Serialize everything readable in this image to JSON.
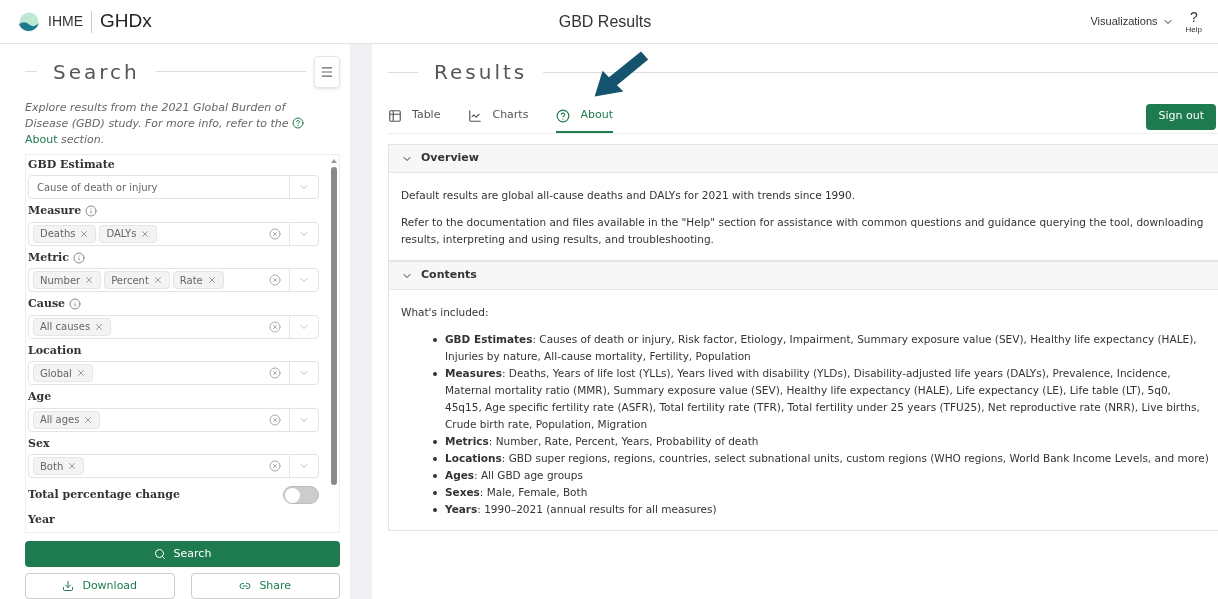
{
  "header": {
    "brand": "IHME",
    "product": "GHDx",
    "title": "GBD Results",
    "menu": "Visualizations",
    "help_glyph": "?",
    "help_label": "Help"
  },
  "sidebar": {
    "title": "Search",
    "description_before": "Explore results from the 2021 Global Burden of Disease (GBD) study. For more info, refer to the",
    "description_link": "About",
    "description_after": "section.",
    "filters": [
      {
        "label": "GBD Estimate",
        "info": false,
        "kind": "select",
        "value": "Cause of death or injury"
      },
      {
        "label": "Measure",
        "info": true,
        "kind": "multi",
        "tags": [
          "Deaths",
          "DALYs"
        ]
      },
      {
        "label": "Metric",
        "info": true,
        "kind": "multi",
        "tags": [
          "Number",
          "Percent",
          "Rate"
        ]
      },
      {
        "label": "Cause",
        "info": true,
        "kind": "multi",
        "tags": [
          "All causes"
        ]
      },
      {
        "label": "Location",
        "info": false,
        "kind": "multi",
        "tags": [
          "Global"
        ]
      },
      {
        "label": "Age",
        "info": false,
        "kind": "multi",
        "tags": [
          "All ages"
        ]
      },
      {
        "label": "Sex",
        "info": false,
        "kind": "multi",
        "tags": [
          "Both"
        ]
      },
      {
        "label": "Total percentage change",
        "kind": "toggle",
        "on": false
      },
      {
        "label": "Year",
        "kind": "heading"
      }
    ],
    "search_button": "Search",
    "download_button": "Download",
    "share_button": "Share"
  },
  "main": {
    "title": "Results",
    "tabs": [
      {
        "label": "Table",
        "kind": "table",
        "selected": false
      },
      {
        "label": "Charts",
        "kind": "chart",
        "selected": false
      },
      {
        "label": "About",
        "kind": "help",
        "selected": true
      }
    ],
    "sign_out": "Sign out",
    "sections": [
      {
        "title": "Overview",
        "expanded": true,
        "paragraphs": [
          "Default results are global all-cause deaths and DALYs for 2021 with trends since 1990.",
          "Refer to the documentation and files available in the \"Help\" section for assistance with common questions and guidance querying the tool, downloading results, interpreting and using results, and troubleshooting."
        ]
      },
      {
        "title": "Contents",
        "expanded": true,
        "paragraphs": [
          "What's included:"
        ],
        "bullets": [
          "**GBD Estimates**: Causes of death or injury, Risk factor, Etiology, Impairment, Summary exposure value (SEV), Healthy life expectancy (HALE), Injuries by nature, All-cause mortality, Fertility, Population",
          "**Measures**: Deaths, Years of life lost (YLLs), Years lived with disability (YLDs), Disability-adjusted life years (DALYs), Prevalence, Incidence, Maternal mortality ratio (MMR), Summary exposure value (SEV), Healthy life expectancy (HALE), Life expectancy (LE), Life table (LT), 5q0, 45q15, Age specific fertility rate (ASFR), Total fertility rate (TFR), Total fertility under 25 years (TFU25), Net reproductive rate (NRR), Live births, Crude birth rate, Population, Migration",
          "**Metrics**: Number, Rate, Percent, Years, Probability of death",
          "**Locations**: GBD super regions, regions, countries, select subnational units, custom regions (WHO regions, World Bank Income Levels, and more)",
          "**Ages**: All GBD age groups",
          "**Sexes**: Male, Female, Both",
          "**Years**: 1990–2021 (annual results for all measures)"
        ]
      }
    ]
  }
}
